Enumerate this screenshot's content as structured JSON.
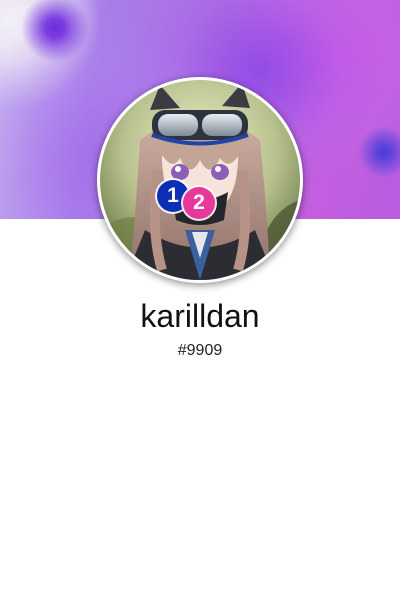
{
  "profile": {
    "username": "karilldan",
    "discriminator": "#9909",
    "banner_colors": [
      "#b06be2",
      "#c35edf",
      "#6c2cd9",
      "#4b35d6"
    ],
    "avatar": {
      "description_icon": "anime-avatar-image",
      "badges": [
        {
          "label": "1",
          "color": "#0d2fb8"
        },
        {
          "label": "2",
          "color": "#e6399b"
        }
      ]
    }
  }
}
